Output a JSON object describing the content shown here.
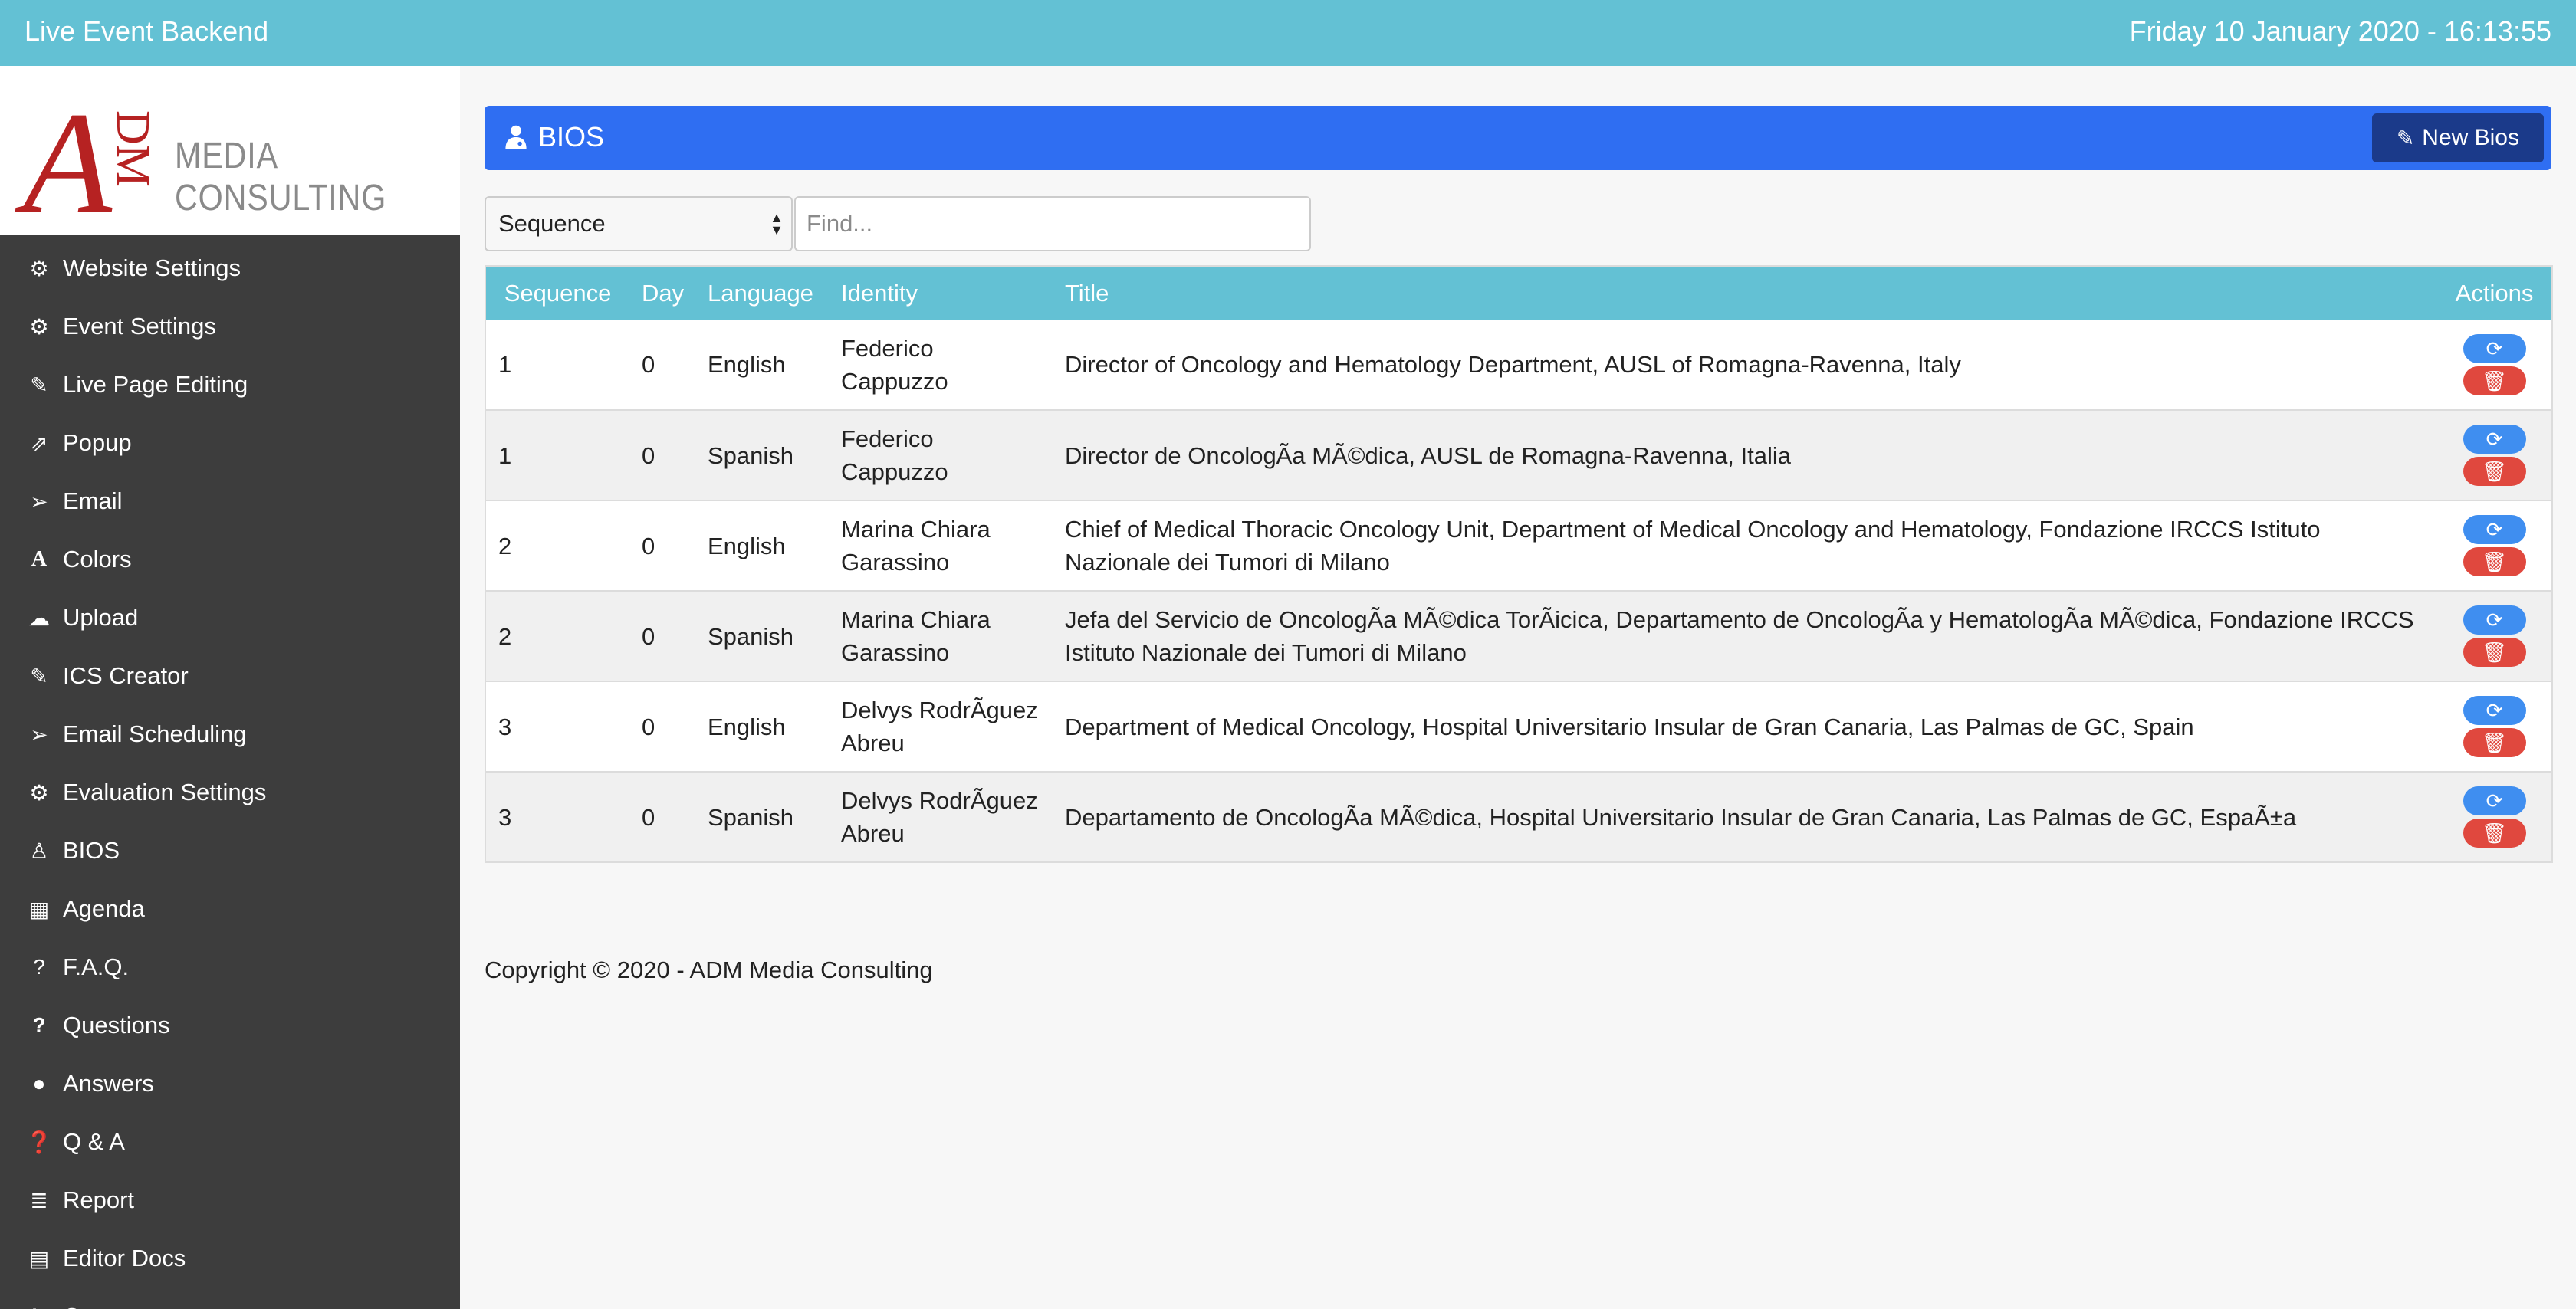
{
  "app": {
    "title": "Live Event Backend",
    "datetime": "Friday 10 January 2020 - 16:13:55"
  },
  "logo": {
    "mark": "A",
    "mark_sub": "DM",
    "text": "MEDIA CONSULTING"
  },
  "sidebar": {
    "items": [
      {
        "label": "Website Settings",
        "icon": "gear-icon"
      },
      {
        "label": "Event Settings",
        "icon": "gear-icon"
      },
      {
        "label": "Live Page Editing",
        "icon": "edit-icon"
      },
      {
        "label": "Popup",
        "icon": "external-link-icon"
      },
      {
        "label": "Email",
        "icon": "paper-plane-icon"
      },
      {
        "label": "Colors",
        "icon": "font-icon"
      },
      {
        "label": "Upload",
        "icon": "cloud-upload-icon"
      },
      {
        "label": "ICS Creator",
        "icon": "paperclip-icon"
      },
      {
        "label": "Email Scheduling",
        "icon": "paper-plane-icon"
      },
      {
        "label": "Evaluation Settings",
        "icon": "gear-icon"
      },
      {
        "label": "BIOS",
        "icon": "user-doctor-icon"
      },
      {
        "label": "Agenda",
        "icon": "calendar-icon"
      },
      {
        "label": "F.A.Q.",
        "icon": "question-circle-icon"
      },
      {
        "label": "Questions",
        "icon": "question-icon"
      },
      {
        "label": "Answers",
        "icon": "comment-icon"
      },
      {
        "label": "Q & A",
        "icon": "question-circle-filled-icon"
      },
      {
        "label": "Report",
        "icon": "database-icon"
      },
      {
        "label": "Editor Docs",
        "icon": "book-icon"
      },
      {
        "label": "Country",
        "icon": "flag-icon"
      }
    ]
  },
  "panel": {
    "title": "BIOS",
    "new_button": "New Bios"
  },
  "filters": {
    "sort_value": "Sequence",
    "find_placeholder": "Find..."
  },
  "table": {
    "headers": [
      "Sequence",
      "Day",
      "Language",
      "Identity",
      "Title",
      "Actions"
    ],
    "rows": [
      {
        "sequence": "1",
        "day": "0",
        "language": "English",
        "identity_1": "Federico",
        "identity_2": "Cappuzzo",
        "title": "Director of Oncology and Hematology Department, AUSL of Romagna-Ravenna, Italy"
      },
      {
        "sequence": "1",
        "day": "0",
        "language": "Spanish",
        "identity_1": "Federico",
        "identity_2": "Cappuzzo",
        "title": "Director de OncologÃa MÃ©dica, AUSL de Romagna-Ravenna, Italia"
      },
      {
        "sequence": "2",
        "day": "0",
        "language": "English",
        "identity_1": "Marina Chiara",
        "identity_2": "Garassino",
        "title": "Chief of Medical Thoracic Oncology Unit, Department of Medical Oncology and Hematology, Fondazione IRCCS Istituto Nazionale dei Tumori di Milano"
      },
      {
        "sequence": "2",
        "day": "0",
        "language": "Spanish",
        "identity_1": "Marina Chiara",
        "identity_2": "Garassino",
        "title": "Jefa del Servicio de OncologÃa MÃ©dica TorÃicica, Departamento de OncologÃa y HematologÃa MÃ©dica, Fondazione IRCCS Istituto Nazionale dei Tumori di Milano"
      },
      {
        "sequence": "3",
        "day": "0",
        "language": "English",
        "identity_1": "Delvys RodrÃguez",
        "identity_2": "Abreu",
        "title": "Department of Medical Oncology, Hospital Universitario Insular de Gran Canaria, Las Palmas de GC, Spain"
      },
      {
        "sequence": "3",
        "day": "0",
        "language": "Spanish",
        "identity_1": "Delvys RodrÃguez",
        "identity_2": "Abreu",
        "title": "Departamento de OncologÃa MÃ©dica, Hospital Universitario Insular de Gran Canaria, Las Palmas de GC, EspaÃ±a"
      }
    ]
  },
  "footer": {
    "copyright": "Copyright © 2020 - ADM Media Consulting"
  },
  "colors": {
    "topbar": "#63c1d4",
    "sidebar": "#3d3d3d",
    "panel_header": "#2f6ef2",
    "new_button": "#1b3a8a",
    "refresh": "#3f8ef0",
    "delete": "#e0483e"
  }
}
